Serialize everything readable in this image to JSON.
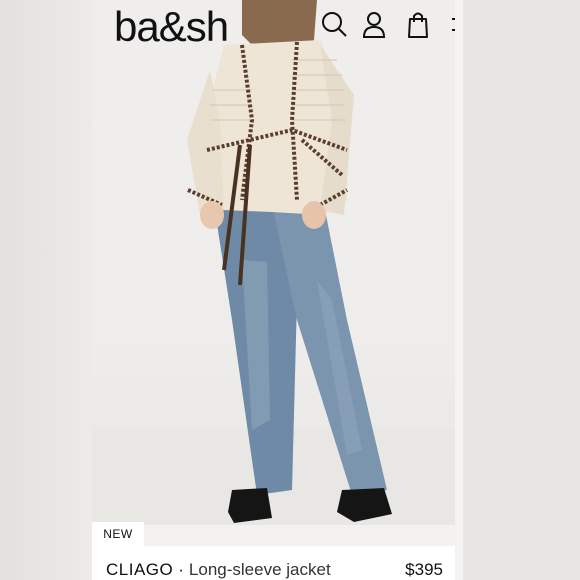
{
  "header": {
    "logo": "ba&sh",
    "icons": [
      "search-icon",
      "account-icon",
      "bag-icon",
      "menu-icon"
    ]
  },
  "product": {
    "badge": "NEW",
    "name": "CLIAGO",
    "separator": "·",
    "description": "Long-sleeve jacket",
    "price": "$395"
  },
  "colors": {
    "jacket": "#eee5d6",
    "trim": "#5b3f2c",
    "denim": "#6b87a3",
    "boots": "#151515"
  }
}
